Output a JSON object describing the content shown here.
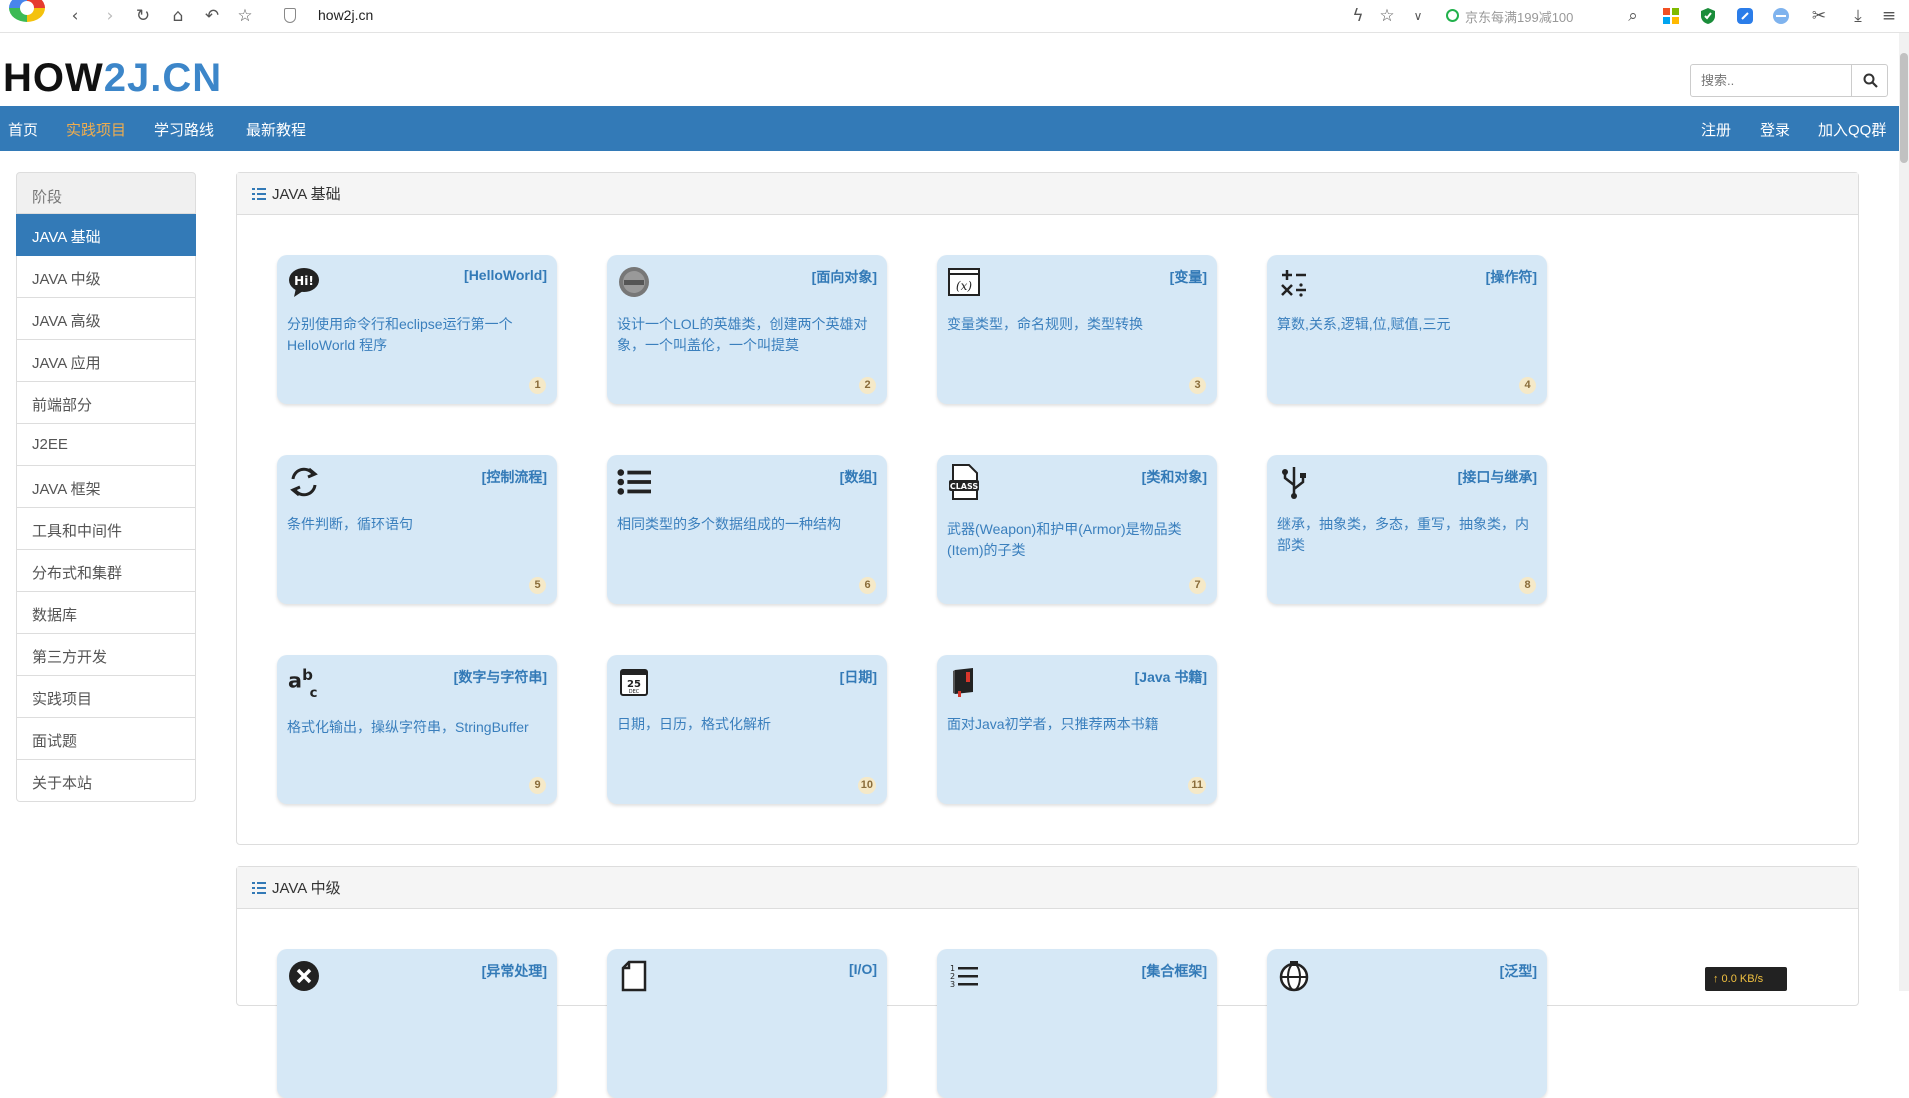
{
  "browser": {
    "url": "how2j.cn",
    "promo": "京东每满199减100",
    "buttons": [
      "back-icon",
      "forward-icon",
      "reload-icon",
      "home-icon",
      "undo-icon",
      "bookmark-star-icon"
    ]
  },
  "header": {
    "logo_part1": "HOW",
    "logo_part2": "2J",
    "logo_part3": ".CN",
    "search_placeholder": "搜索.."
  },
  "nav": {
    "left": [
      "首页",
      "实践项目",
      "学习路线",
      "最新教程"
    ],
    "active": "实践项目",
    "right": [
      "注册",
      "登录",
      "加入QQ群"
    ]
  },
  "sidebar": {
    "heading": "阶段",
    "items": [
      "JAVA 基础",
      "JAVA 中级",
      "JAVA 高级",
      "JAVA 应用",
      "前端部分",
      "J2EE",
      "JAVA 框架",
      "工具和中间件",
      "分布式和集群",
      "数据库",
      "第三方开发",
      "实践项目",
      "面试题",
      "关于本站"
    ],
    "active": "JAVA 基础"
  },
  "sections": [
    {
      "title": "JAVA 基础",
      "cards": [
        {
          "icon": "hi-speech-icon",
          "tag": "[HelloWorld]",
          "desc": "分别使用命令行和eclipse运行第一个HelloWorld 程序",
          "num": "1"
        },
        {
          "icon": "object-badge-icon",
          "tag": "[面向对象]",
          "desc": "设计一个LOL的英雄类，创建两个英雄对象，一个叫盖伦，一个叫提莫",
          "num": "2"
        },
        {
          "icon": "variable-icon",
          "tag": "[变量]",
          "desc": "变量类型，命名规则，类型转换",
          "num": "3"
        },
        {
          "icon": "operators-icon",
          "tag": "[操作符]",
          "desc": "算数,关系,逻辑,位,赋值,三元",
          "num": "4"
        },
        {
          "icon": "loop-arrows-icon",
          "tag": "[控制流程]",
          "desc": "条件判断，循环语句",
          "num": "5"
        },
        {
          "icon": "list-icon",
          "tag": "[数组]",
          "desc": "相同类型的多个数据组成的一种结构",
          "num": "6"
        },
        {
          "icon": "class-file-icon",
          "tag": "[类和对象]",
          "desc": "武器(Weapon)和护甲(Armor)是物品类(Item)的子类",
          "num": "7"
        },
        {
          "icon": "usb-fork-icon",
          "tag": "[接口与继承]",
          "desc": "继承，抽象类，多态，重写，抽象类，内部类",
          "num": "8"
        },
        {
          "icon": "abc-letters-icon",
          "tag": "[数字与字符串]",
          "desc": "格式化输出，操纵字符串，StringBuffer",
          "num": "9"
        },
        {
          "icon": "calendar-icon",
          "tag": "[日期]",
          "desc": "日期，日历，格式化解析",
          "num": "10"
        },
        {
          "icon": "book-icon",
          "tag": "[Java 书籍]",
          "desc": "面对Java初学者，只推荐两本书籍",
          "num": "11"
        }
      ]
    },
    {
      "title": "JAVA 中级",
      "cards": [
        {
          "icon": "error-x-icon",
          "tag": "[异常处理]"
        },
        {
          "icon": "file-io-icon",
          "tag": "[I/O]"
        },
        {
          "icon": "ordered-list-icon",
          "tag": "[集合框架]"
        },
        {
          "icon": "globe-icon",
          "tag": "[泛型]"
        }
      ]
    }
  ],
  "speed_widget": "↑ 0.0 KB/s"
}
